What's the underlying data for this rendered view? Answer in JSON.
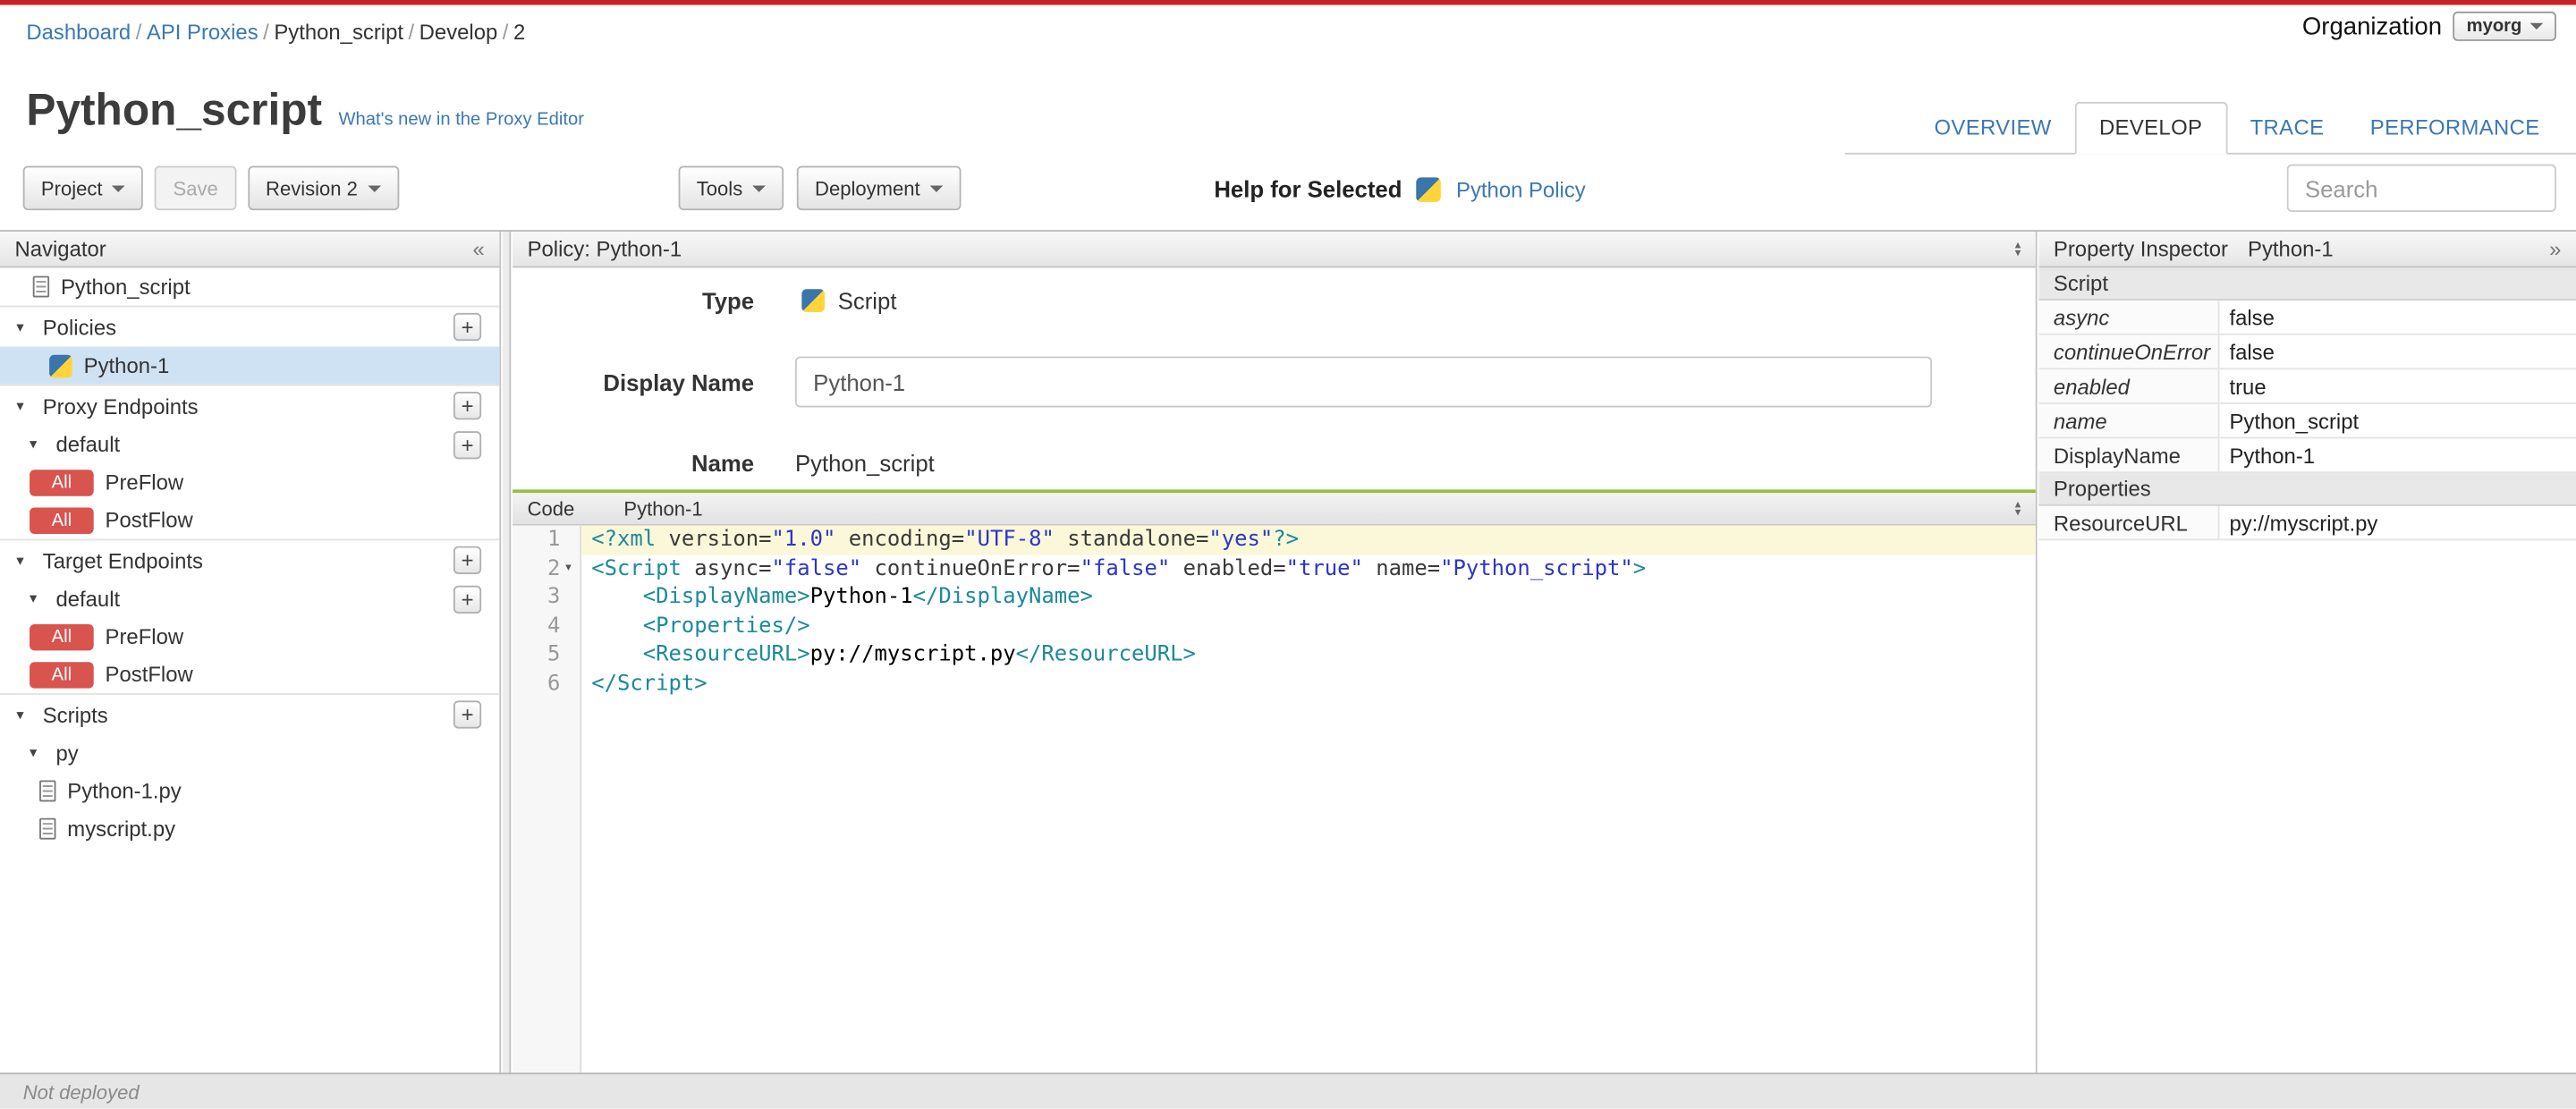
{
  "colors": {
    "accent_red": "#cb2026",
    "link_blue": "#3b78b5",
    "badge_red": "#d9534f",
    "selected_row_blue": "#cfe2f4",
    "code_divider_green": "#9abd3f",
    "active_line_yellow": "#fbf8da"
  },
  "breadcrumb": {
    "separator": "/",
    "items": [
      {
        "label": "Dashboard",
        "link": true
      },
      {
        "label": "API Proxies",
        "link": true
      },
      {
        "label": "Python_script",
        "link": false
      },
      {
        "label": "Develop",
        "link": false
      },
      {
        "label": "2",
        "link": false
      }
    ]
  },
  "organization": {
    "label": "Organization",
    "value": "myorg"
  },
  "header": {
    "title": "Python_script",
    "whats_new_link": "What's new in the Proxy Editor",
    "tabs": [
      {
        "label": "OVERVIEW",
        "active": false
      },
      {
        "label": "DEVELOP",
        "active": true
      },
      {
        "label": "TRACE",
        "active": false
      },
      {
        "label": "PERFORMANCE",
        "active": false
      }
    ]
  },
  "toolbar": {
    "project_label": "Project",
    "save_label": "Save",
    "revision_label": "Revision 2",
    "tools_label": "Tools",
    "deployment_label": "Deployment",
    "help_for_selected_label": "Help for Selected",
    "help_link_label": "Python Policy",
    "search_placeholder": "Search"
  },
  "navigator": {
    "title": "Navigator",
    "tree": [
      {
        "type": "file",
        "icon": "document",
        "label": "Python_script"
      },
      {
        "type": "section",
        "caret": true,
        "label": "Policies",
        "add": true
      },
      {
        "type": "policy",
        "icon": "python",
        "label": "Python-1",
        "selected": true
      },
      {
        "type": "section",
        "caret": true,
        "label": "Proxy Endpoints",
        "add": true
      },
      {
        "type": "group",
        "caret": true,
        "label": "default",
        "add": true
      },
      {
        "type": "flow",
        "badge": "All",
        "label": "PreFlow"
      },
      {
        "type": "flow",
        "badge": "All",
        "label": "PostFlow"
      },
      {
        "type": "section",
        "caret": true,
        "label": "Target Endpoints",
        "add": true
      },
      {
        "type": "group",
        "caret": true,
        "label": "default",
        "add": true
      },
      {
        "type": "flow",
        "badge": "All",
        "label": "PreFlow"
      },
      {
        "type": "flow",
        "badge": "All",
        "label": "PostFlow"
      },
      {
        "type": "section",
        "caret": true,
        "label": "Scripts",
        "add": true
      },
      {
        "type": "group",
        "caret": true,
        "label": "py"
      },
      {
        "type": "file",
        "icon": "document",
        "label": "Python-1.py",
        "nested": true
      },
      {
        "type": "file",
        "icon": "document",
        "label": "myscript.py",
        "nested": true
      }
    ]
  },
  "policy_panel": {
    "title": "Policy: Python-1",
    "type_label": "Type",
    "type_value": "Script",
    "display_name_label": "Display Name",
    "display_name_value": "Python-1",
    "name_label": "Name",
    "name_value": "Python_script"
  },
  "code_editor": {
    "tab_label": "Code",
    "file_label": "Python-1",
    "lines": [
      {
        "n": "1",
        "active": true,
        "tokens": [
          {
            "c": "meta",
            "v": "<?xml "
          },
          {
            "c": "attr",
            "v": "version="
          },
          {
            "c": "str",
            "v": "\"1.0\""
          },
          {
            "c": "attr",
            "v": " encoding="
          },
          {
            "c": "str",
            "v": "\"UTF-8\""
          },
          {
            "c": "attr",
            "v": " standalone="
          },
          {
            "c": "str",
            "v": "\"yes\""
          },
          {
            "c": "meta",
            "v": "?>"
          }
        ]
      },
      {
        "n": "2",
        "fold": true,
        "tokens": [
          {
            "c": "tag",
            "v": "<Script "
          },
          {
            "c": "attr",
            "v": "async="
          },
          {
            "c": "str",
            "v": "\"false\""
          },
          {
            "c": "attr",
            "v": " continueOnError="
          },
          {
            "c": "str",
            "v": "\"false\""
          },
          {
            "c": "attr",
            "v": " enabled="
          },
          {
            "c": "str",
            "v": "\"true\""
          },
          {
            "c": "attr",
            "v": " name="
          },
          {
            "c": "str",
            "v": "\"Python_script\""
          },
          {
            "c": "tag",
            "v": ">"
          }
        ]
      },
      {
        "n": "3",
        "tokens": [
          {
            "c": "text",
            "v": "    "
          },
          {
            "c": "tag",
            "v": "<DisplayName>"
          },
          {
            "c": "text",
            "v": "Python-1"
          },
          {
            "c": "tag",
            "v": "</DisplayName>"
          }
        ]
      },
      {
        "n": "4",
        "tokens": [
          {
            "c": "text",
            "v": "    "
          },
          {
            "c": "tag",
            "v": "<Properties/>"
          }
        ]
      },
      {
        "n": "5",
        "tokens": [
          {
            "c": "text",
            "v": "    "
          },
          {
            "c": "tag",
            "v": "<ResourceURL>"
          },
          {
            "c": "text",
            "v": "py://myscript.py"
          },
          {
            "c": "tag",
            "v": "</ResourceURL>"
          }
        ]
      },
      {
        "n": "6",
        "tokens": [
          {
            "c": "tag",
            "v": "</Script>"
          }
        ]
      }
    ]
  },
  "property_inspector": {
    "title": "Property Inspector",
    "subtitle": "Python-1",
    "rows": [
      {
        "kind": "section",
        "label": "Script"
      },
      {
        "kind": "prop",
        "label": "async",
        "value": "false",
        "italic": true
      },
      {
        "kind": "prop",
        "label": "continueOnError",
        "value": "false",
        "italic": true
      },
      {
        "kind": "prop",
        "label": "enabled",
        "value": "true",
        "italic": true
      },
      {
        "kind": "prop",
        "label": "name",
        "value": "Python_script",
        "italic": true
      },
      {
        "kind": "prop",
        "label": "DisplayName",
        "value": "Python-1",
        "italic": false
      },
      {
        "kind": "section",
        "label": "Properties"
      },
      {
        "kind": "prop",
        "label": "ResourceURL",
        "value": "py://myscript.py",
        "italic": false
      }
    ]
  },
  "status_bar": {
    "text": "Not deployed"
  }
}
